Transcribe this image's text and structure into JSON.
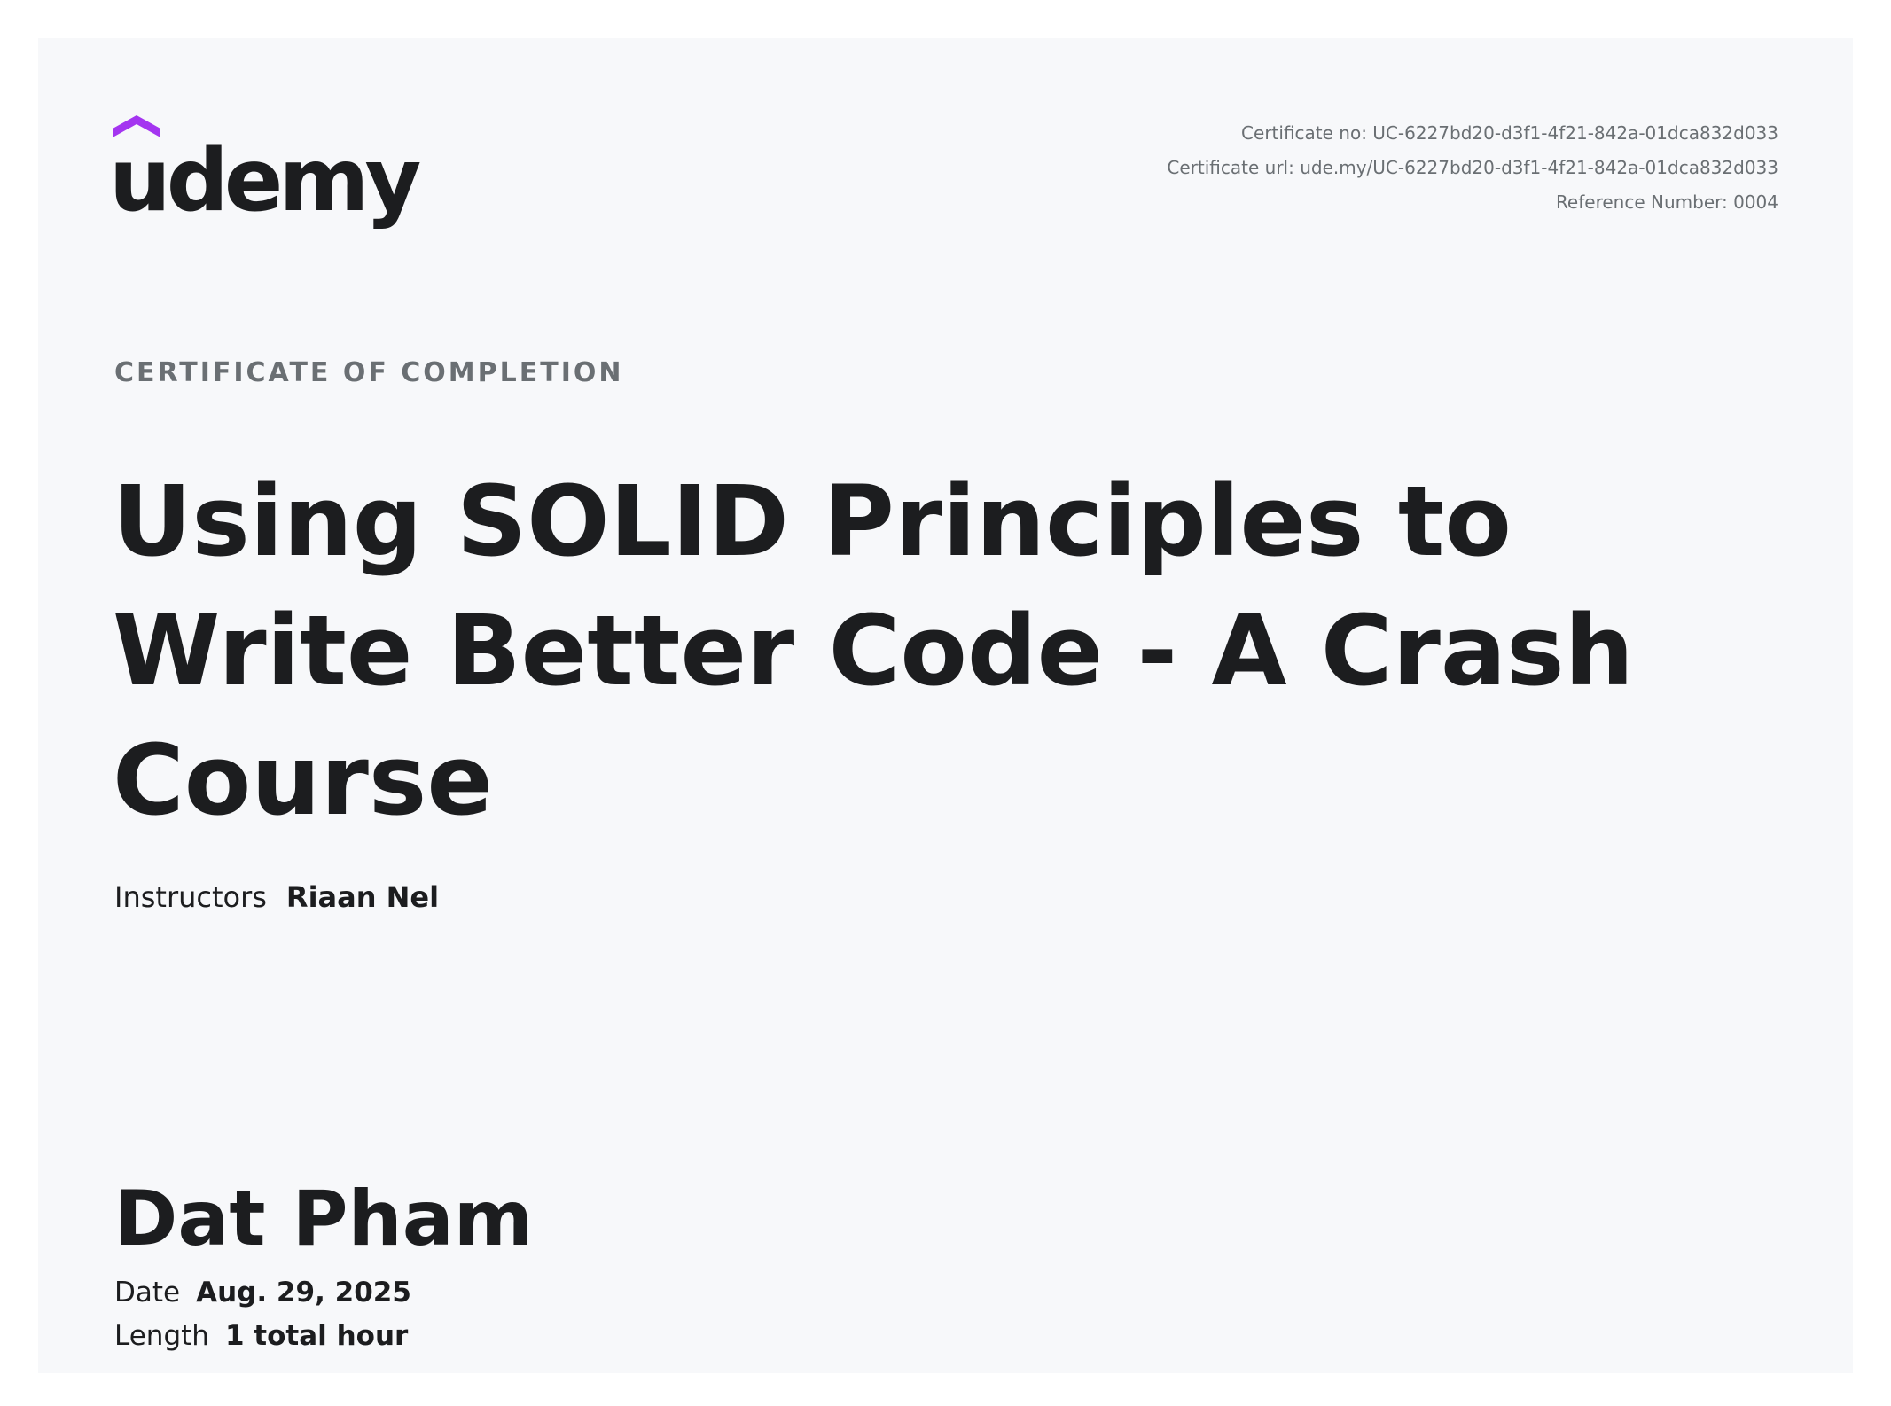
{
  "brand": {
    "logo_text": "udemy",
    "accent_color": "#a435f0",
    "text_color": "#1c1d1f"
  },
  "certificate": {
    "number_line": "Certificate no: UC-6227bd20-d3f1-4f21-842a-01dca832d033",
    "url_line": "Certificate url: ude.my/UC-6227bd20-d3f1-4f21-842a-01dca832d033",
    "reference_line": "Reference Number: 0004",
    "kicker": "CERTIFICATE OF COMPLETION",
    "title_lines": [
      "Using SOLID Principles to",
      "Write Better Code - A Crash",
      "Course"
    ],
    "instructors_label": "Instructors",
    "instructors_value": "Riaan Nel",
    "student_name": "Dat Pham",
    "date_label": "Date",
    "date_value": "Aug. 29, 2025",
    "length_label": "Length",
    "length_value": "1 total hour"
  }
}
